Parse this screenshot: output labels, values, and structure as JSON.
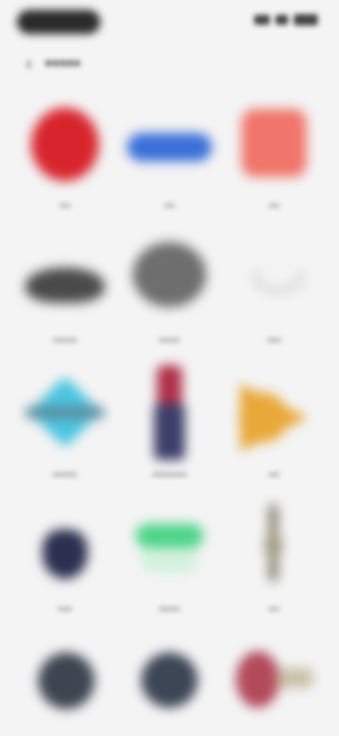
{
  "status_bar": {
    "icons": [
      "signal-icon",
      "wifi-icon",
      "battery-icon"
    ]
  },
  "header": {
    "back_icon": "back-arrow-icon",
    "title": "•••••"
  },
  "grid": {
    "items": [
      {
        "label": "•••",
        "color": "#d8252d"
      },
      {
        "label": "•••",
        "color": "#3a6fd8"
      },
      {
        "label": "•••",
        "color": "#f0756a"
      },
      {
        "label": "•••••••",
        "color": "#4a4a4a"
      },
      {
        "label": "••••••",
        "color": "#6e6e6e"
      },
      {
        "label": "••••",
        "color": "#b8b8b8"
      },
      {
        "label": "•••••••",
        "color": "#4cc4e0"
      },
      {
        "label": "••••••••••",
        "color": "#3c3f6a"
      },
      {
        "label": "•••",
        "color": "#e9a83a"
      },
      {
        "label": "••••",
        "color": "#2c3050"
      },
      {
        "label": "••••••",
        "color": "#4fd48a"
      },
      {
        "label": "•••",
        "color": "#8a8470"
      },
      {
        "label": "",
        "color": "#3e4550"
      },
      {
        "label": "",
        "color": "#3c4655"
      },
      {
        "label": "",
        "color": "#b24a5c"
      }
    ]
  }
}
